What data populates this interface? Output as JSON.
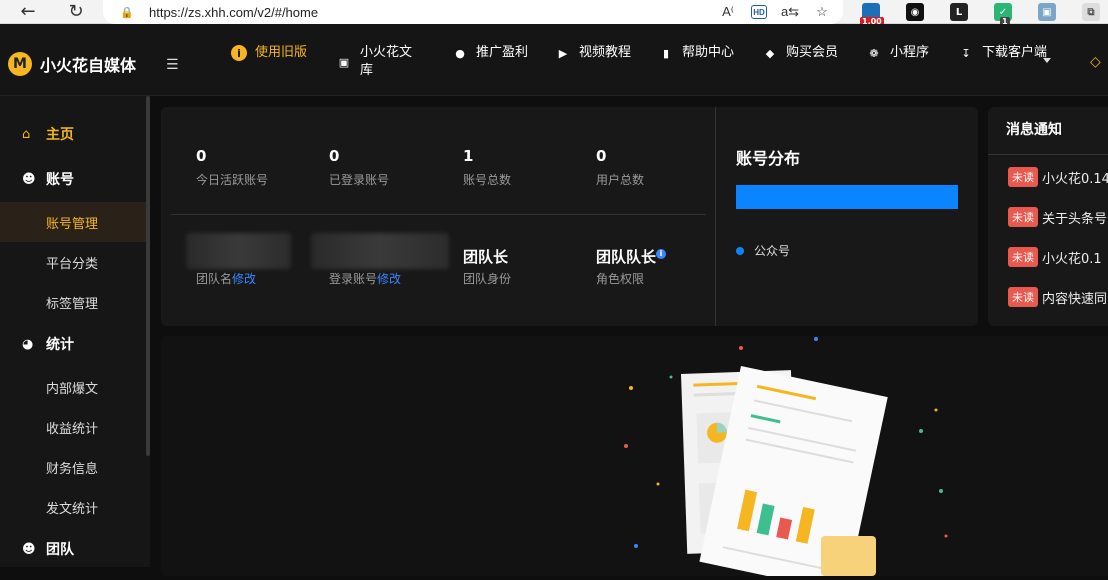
{
  "browser": {
    "url": "https://zs.xhh.com/v2/#/home",
    "extension_badge_1": "1.00",
    "extension_badge_2": "1"
  },
  "app": {
    "logo_mark": "M",
    "name": "小火花自媒体"
  },
  "topnav": [
    {
      "label": "使用旧版",
      "icon": "info-icon"
    },
    {
      "label": "小火花文库",
      "icon": "book-icon"
    },
    {
      "label": "推广盈利",
      "icon": "money-bag-icon"
    },
    {
      "label": "视频教程",
      "icon": "video-icon"
    },
    {
      "label": "帮助中心",
      "icon": "help-book-icon"
    },
    {
      "label": "购买会员",
      "icon": "vip-icon"
    },
    {
      "label": "小程序",
      "icon": "mini-program-icon"
    },
    {
      "label": "下载客户端",
      "icon": "download-icon"
    }
  ],
  "sidebar": {
    "home": "主页",
    "account": "账号",
    "account_manage": "账号管理",
    "platform_category": "平台分类",
    "tag_manage": "标签管理",
    "stats": "统计",
    "internal_hits": "内部爆文",
    "income_stats": "收益统计",
    "finance_info": "财务信息",
    "post_stats": "发文统计",
    "team": "团队"
  },
  "stats": [
    {
      "value": "0",
      "label": "今日活跃账号"
    },
    {
      "value": "0",
      "label": "已登录账号"
    },
    {
      "value": "1",
      "label": "账号总数"
    },
    {
      "value": "0",
      "label": "用户总数"
    }
  ],
  "team_info": {
    "team_name_label": "团队名",
    "edit": "修改",
    "login_account_label": "登录账号",
    "identity_value": "团队长",
    "identity_label": "团队身份",
    "role_value": "团队队长",
    "role_label": "角色权限"
  },
  "distribution": {
    "title": "账号分布",
    "legend": "公众号",
    "color": "#0a84ff"
  },
  "notices": {
    "title": "消息通知",
    "unread_label": "未读",
    "items": [
      "小火花0.14",
      "关于头条号",
      "小火花0.1",
      "内容快速同"
    ]
  },
  "colors": {
    "accent": "#f5b621",
    "unread": "#e8594f",
    "link": "#3a86ff"
  }
}
